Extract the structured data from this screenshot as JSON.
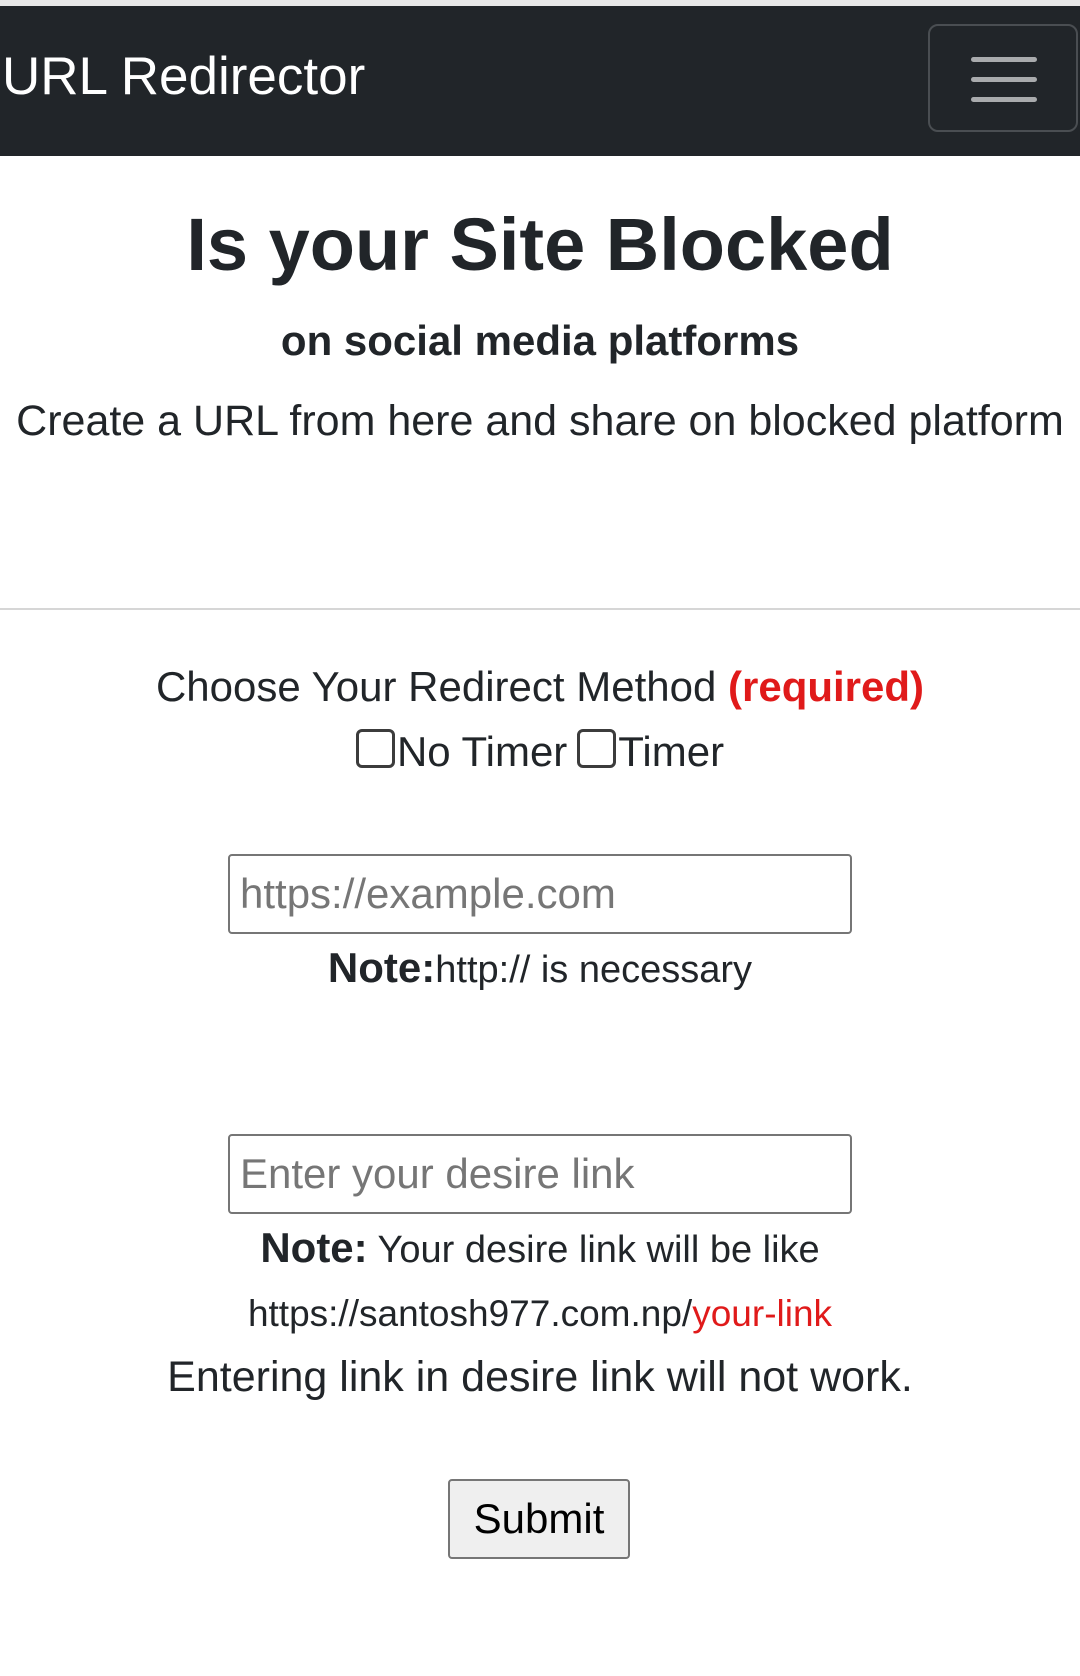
{
  "navbar": {
    "brand": "URL Redirector",
    "toggler_icon": "hamburger-menu-icon"
  },
  "hero": {
    "title": "Is your Site Blocked",
    "subtitle": "on social media platforms",
    "lead": "Create a URL from here and share on blocked platform"
  },
  "form": {
    "method_label": "Choose Your Redirect Method",
    "required_label": "(required)",
    "options": [
      {
        "label": "No Timer",
        "checked": false
      },
      {
        "label": "Timer",
        "checked": false
      }
    ],
    "url_input": {
      "value": "",
      "placeholder": "https://example.com"
    },
    "url_note_bold": "Note:",
    "url_note_text": "http:// is necessary",
    "link_input": {
      "value": "",
      "placeholder": "Enter your desire link"
    },
    "link_note_bold": "Note:",
    "link_note_text": " Your desire link will be like",
    "example_prefix": "https://santosh977.com.np/",
    "example_suffix": "your-link",
    "warning": "Entering link in desire link will not work.",
    "submit_label": "Submit"
  },
  "colors": {
    "navbar_bg": "#212529",
    "required_red": "#e01a1a",
    "text": "#212529"
  }
}
